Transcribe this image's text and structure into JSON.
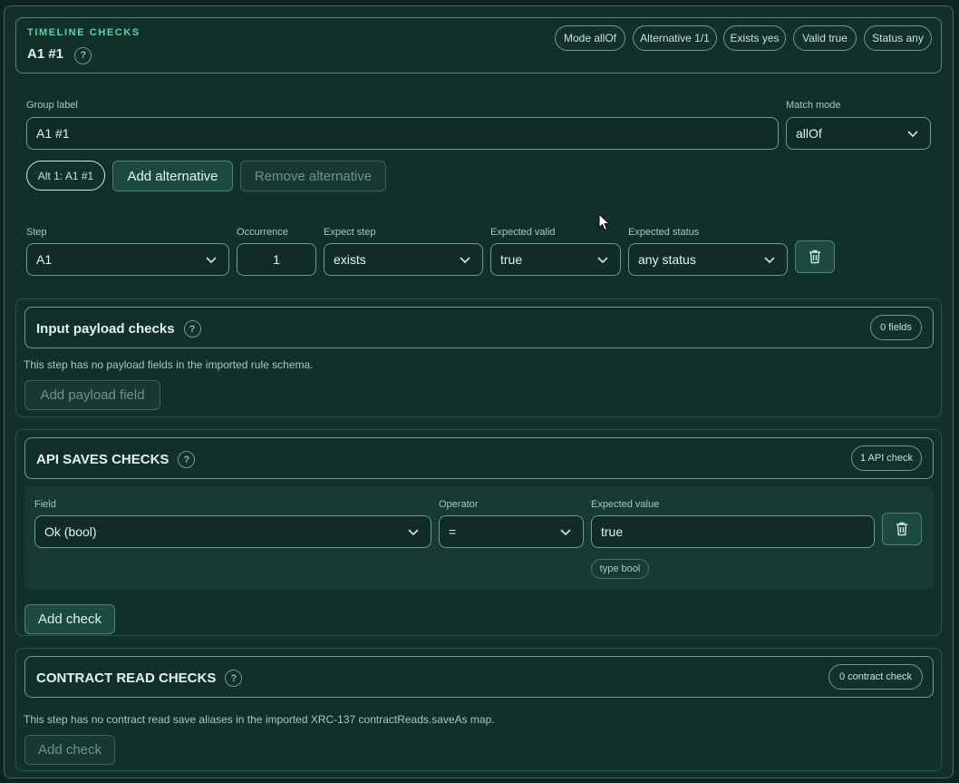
{
  "header": {
    "eyebrow": "TIMELINE CHECKS",
    "title": "A1 #1",
    "help": "?",
    "chips": [
      "Mode allOf",
      "Alternative 1/1",
      "Exists yes",
      "Valid true",
      "Status any"
    ]
  },
  "group": {
    "label_caption": "Group label",
    "label_value": "A1 #1",
    "match_caption": "Match mode",
    "match_value": "allOf",
    "alt_pill": "Alt 1: A1 #1",
    "add_alt": "Add alternative",
    "remove_alt": "Remove alternative"
  },
  "step": {
    "step_caption": "Step",
    "step_value": "A1",
    "occ_caption": "Occurrence",
    "occ_value": "1",
    "expect_caption": "Expect step",
    "expect_value": "exists",
    "valid_caption": "Expected valid",
    "valid_value": "true",
    "status_caption": "Expected status",
    "status_value": "any status"
  },
  "payload": {
    "title": "Input payload checks",
    "help": "?",
    "count": "0 fields",
    "note": "This step has no payload fields in the imported rule schema.",
    "add": "Add payload field"
  },
  "api": {
    "title": "API SAVES CHECKS",
    "help": "?",
    "count": "1 API check",
    "field_caption": "Field",
    "field_value": "Ok (bool)",
    "op_caption": "Operator",
    "op_value": "=",
    "exp_caption": "Expected value",
    "exp_value": "true",
    "type_tag": "type bool",
    "add": "Add check"
  },
  "contract": {
    "title": "CONTRACT READ CHECKS",
    "help": "?",
    "count": "0 contract check",
    "note": "This step has no contract read save aliases in the imported XRC-137 contractReads.saveAs map.",
    "add": "Add check"
  },
  "icons": {
    "select": "chevron-down-icon",
    "delete": "trash-icon",
    "cursor": "mouse-pointer-icon"
  },
  "colors": {
    "accent": "#4fd7a4",
    "background": "#13302a",
    "border": "#6b9c8d"
  }
}
